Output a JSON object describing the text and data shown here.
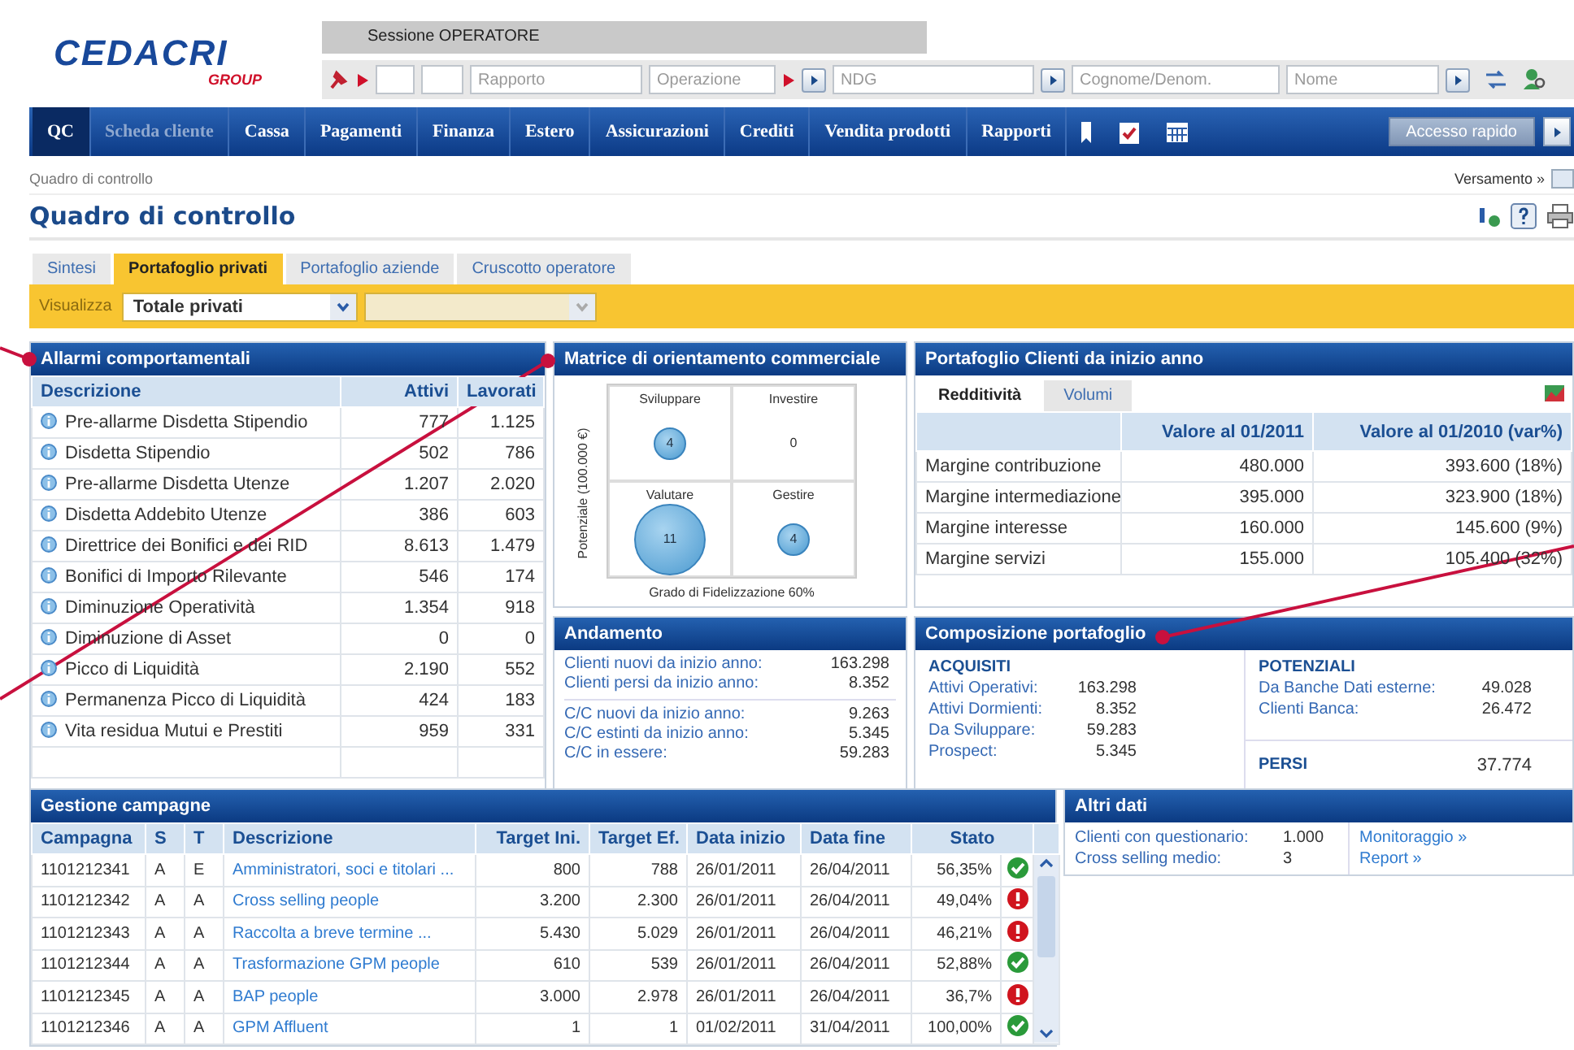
{
  "header": {
    "logo": {
      "name": "CEDACRI",
      "sub": "GROUP"
    },
    "session": "Sessione OPERATORE",
    "fields": [
      {
        "placeholder": "Rapporto",
        "marker": false,
        "go": false
      },
      {
        "placeholder": "Operazione",
        "marker": true,
        "go": true
      },
      {
        "placeholder": "NDG",
        "marker": false,
        "go": true
      },
      {
        "placeholder": "Cognome/Denom.",
        "marker": false,
        "go": false
      },
      {
        "placeholder": "Nome",
        "marker": false,
        "go": true
      }
    ]
  },
  "nav": {
    "items": [
      {
        "label": "QC",
        "selected": true,
        "disabled": false
      },
      {
        "label": "Scheda cliente",
        "selected": false,
        "disabled": true
      },
      {
        "label": "Cassa",
        "selected": false,
        "disabled": false
      },
      {
        "label": "Pagamenti",
        "selected": false,
        "disabled": false
      },
      {
        "label": "Finanza",
        "selected": false,
        "disabled": false
      },
      {
        "label": "Estero",
        "selected": false,
        "disabled": false
      },
      {
        "label": "Assicurazioni",
        "selected": false,
        "disabled": false
      },
      {
        "label": "Crediti",
        "selected": false,
        "disabled": false
      },
      {
        "label": "Vendita prodotti",
        "selected": false,
        "disabled": false
      },
      {
        "label": "Rapporti",
        "selected": false,
        "disabled": false
      }
    ],
    "quick_access": "Accesso rapido"
  },
  "breadcrumb": "Quadro di controllo",
  "breadcrumb_link": "Versamento »",
  "title": "Quadro di controllo",
  "tabs": [
    {
      "label": "Sintesi",
      "selected": false
    },
    {
      "label": "Portafoglio privati",
      "selected": true
    },
    {
      "label": "Portafoglio aziende",
      "selected": false
    },
    {
      "label": "Cruscotto operatore",
      "selected": false
    }
  ],
  "filter": {
    "label": "Visualizza",
    "value": "Totale privati",
    "secondary_disabled": true
  },
  "alarms": {
    "title": "Allarmi comportamentali",
    "columns": [
      "Descrizione",
      "Attivi",
      "Lavorati"
    ],
    "rows": [
      {
        "description": "Pre-allarme Disdetta Stipendio",
        "active": "777",
        "worked": "1.125"
      },
      {
        "description": "Disdetta Stipendio",
        "active": "502",
        "worked": "786"
      },
      {
        "description": "Pre-allarme Disdetta Utenze",
        "active": "1.207",
        "worked": "2.020"
      },
      {
        "description": "Disdetta Addebito Utenze",
        "active": "386",
        "worked": "603"
      },
      {
        "description": "Direttrice dei Bonifici e dei RID",
        "active": "8.613",
        "worked": "1.479"
      },
      {
        "description": "Bonifici di Importo Rilevante",
        "active": "546",
        "worked": "174"
      },
      {
        "description": "Diminuzione Operatività",
        "active": "1.354",
        "worked": "918"
      },
      {
        "description": "Diminuzione di Asset",
        "active": "0",
        "worked": "0"
      },
      {
        "description": "Picco di Liquidità",
        "active": "2.190",
        "worked": "552"
      },
      {
        "description": "Permanenza Picco di Liquidità",
        "active": "424",
        "worked": "183"
      },
      {
        "description": "Vita residua Mutui e Prestiti",
        "active": "959",
        "worked": "331"
      }
    ]
  },
  "matrix": {
    "title": "Matrice di orientamento commerciale",
    "y_axis": "Potenziale (100.000 €)",
    "x_axis": "Grado di Fidelizzazione 60%",
    "cells": [
      {
        "label": "Sviluppare",
        "count": "4"
      },
      {
        "label": "Investire",
        "count": "0"
      },
      {
        "label": "Valutare",
        "count": "11"
      },
      {
        "label": "Gestire",
        "count": "4"
      }
    ]
  },
  "portfolio": {
    "title": "Portafoglio Clienti da inizio anno",
    "tabs": [
      {
        "label": "Redditività",
        "selected": true
      },
      {
        "label": "Volumi",
        "selected": false
      }
    ],
    "columns": [
      "Valore al 01/2011",
      "Valore al 01/2010 (var%)"
    ],
    "rows": [
      {
        "label": "Margine contribuzione",
        "v2011": "480.000",
        "v2010": "393.600 (18%)"
      },
      {
        "label": "Margine intermediazione",
        "v2011": "395.000",
        "v2010": "323.900 (18%)"
      },
      {
        "label": "Margine interesse",
        "v2011": "160.000",
        "v2010": "145.600 (9%)"
      },
      {
        "label": "Margine servizi",
        "v2011": "155.000",
        "v2010": "105.400 (32%)"
      }
    ]
  },
  "trend": {
    "title": "Andamento",
    "groups": [
      [
        {
          "label": "Clienti nuovi da inizio anno:",
          "value": "163.298"
        },
        {
          "label": "Clienti persi da inizio anno:",
          "value": "8.352"
        }
      ],
      [
        {
          "label": "C/C nuovi da inizio anno:",
          "value": "9.263"
        },
        {
          "label": "C/C estinti da inizio anno:",
          "value": "5.345"
        },
        {
          "label": "C/C in essere:",
          "value": "59.283"
        }
      ]
    ]
  },
  "composition": {
    "title": "Composizione portafoglio",
    "acquired": {
      "title": "ACQUISITI",
      "rows": [
        {
          "label": "Attivi Operativi:",
          "value": "163.298"
        },
        {
          "label": "Attivi Dormienti:",
          "value": "8.352"
        },
        {
          "label": "Da Sviluppare:",
          "value": "59.283"
        },
        {
          "label": "Prospect:",
          "value": "5.345"
        }
      ]
    },
    "potential": {
      "title": "POTENZIALI",
      "rows": [
        {
          "label": "Da Banche Dati esterne:",
          "value": "49.028"
        },
        {
          "label": "Clienti Banca:",
          "value": "26.472"
        }
      ]
    },
    "lost": {
      "title": "PERSI",
      "value": "37.774"
    }
  },
  "campaigns": {
    "title": "Gestione campagne",
    "columns": [
      "Campagna",
      "S",
      "T",
      "Descrizione",
      "Target Ini.",
      "Target Ef.",
      "Data inizio",
      "Data fine",
      "Stato"
    ],
    "rows": [
      {
        "id": "1101212341",
        "s": "A",
        "t": "E",
        "description": "Amministratori, soci e titolari ...",
        "target_ini": "800",
        "target_ef": "788",
        "start": "26/01/2011",
        "end": "26/04/2011",
        "progress": "56,35%",
        "kind": "ok"
      },
      {
        "id": "1101212342",
        "s": "A",
        "t": "A",
        "description": "Cross selling people",
        "target_ini": "3.200",
        "target_ef": "2.300",
        "start": "26/01/2011",
        "end": "26/04/2011",
        "progress": "49,04%",
        "kind": "alert"
      },
      {
        "id": "1101212343",
        "s": "A",
        "t": "A",
        "description": "Raccolta a breve termine ...",
        "target_ini": "5.430",
        "target_ef": "5.029",
        "start": "26/01/2011",
        "end": "26/04/2011",
        "progress": "46,21%",
        "kind": "alert"
      },
      {
        "id": "1101212344",
        "s": "A",
        "t": "A",
        "description": "Trasformazione GPM people",
        "target_ini": "610",
        "target_ef": "539",
        "start": "26/01/2011",
        "end": "26/04/2011",
        "progress": "52,88%",
        "kind": "ok"
      },
      {
        "id": "1101212345",
        "s": "A",
        "t": "A",
        "description": "BAP people",
        "target_ini": "3.000",
        "target_ef": "2.978",
        "start": "26/01/2011",
        "end": "26/04/2011",
        "progress": "36,7%",
        "kind": "alert"
      },
      {
        "id": "1101212346",
        "s": "A",
        "t": "A",
        "description": "GPM Affluent",
        "target_ini": "1",
        "target_ef": "1",
        "start": "01/02/2011",
        "end": "31/04/2011",
        "progress": "100,00%",
        "kind": "ok"
      }
    ]
  },
  "other": {
    "title": "Altri dati",
    "rows": [
      {
        "label": "Clienti con questionario:",
        "value": "1.000"
      },
      {
        "label": "Cross selling medio:",
        "value": "3"
      }
    ],
    "links": [
      "Monitoraggio »",
      "Report »"
    ]
  }
}
